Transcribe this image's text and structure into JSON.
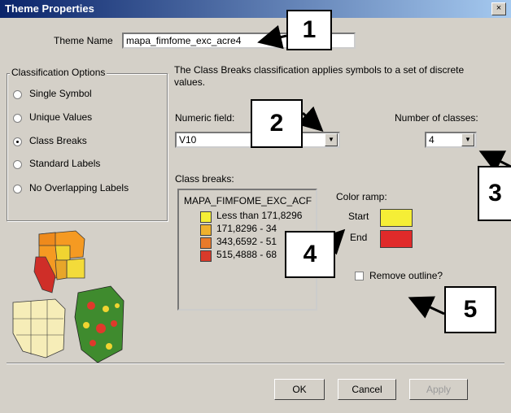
{
  "window": {
    "title": "Theme Properties",
    "close_label": "×"
  },
  "theme_name": {
    "label": "Theme Name",
    "value": "mapa_fimfome_exc_acre4"
  },
  "classification": {
    "group_label": "Classification Options",
    "options": [
      "Single Symbol",
      "Unique Values",
      "Class Breaks",
      "Standard Labels",
      "No Overlapping Labels"
    ],
    "selected_index": 2
  },
  "description": "The Class Breaks classification applies symbols to a set of discrete values.",
  "numeric_field": {
    "label": "Numeric field:",
    "value": "V10"
  },
  "number_of_classes": {
    "label": "Number of classes:",
    "value": "4"
  },
  "class_breaks": {
    "label": "Class breaks:",
    "header": "MAPA_FIMFOME_EXC_ACF",
    "items": [
      {
        "label": "Less than 171,8296",
        "color": "#f5ee36"
      },
      {
        "label": "171,8296 - 34",
        "color": "#efb12d"
      },
      {
        "label": "343,6592 - 51",
        "color": "#e87a2b"
      },
      {
        "label": "515,4888 - 68",
        "color": "#d93a2a"
      }
    ]
  },
  "color_ramp": {
    "label": "Color ramp:",
    "start_label": "Start",
    "end_label": "End",
    "start_color": "#f5ee36",
    "end_color": "#e02a2a"
  },
  "remove_outline": {
    "label": "Remove outline?",
    "checked": false
  },
  "buttons": {
    "ok": "OK",
    "cancel": "Cancel",
    "apply": "Apply"
  },
  "callouts": [
    "1",
    "2",
    "3",
    "4",
    "5"
  ]
}
